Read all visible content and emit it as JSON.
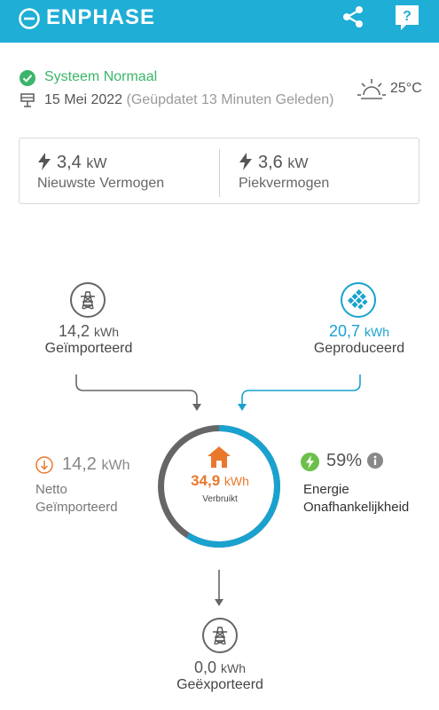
{
  "header": {
    "logo_text": "ENPHASE",
    "share_icon": "share-icon",
    "help_icon": "help-icon"
  },
  "status": {
    "text": "Systeem Normaal",
    "color": "#3ab56a"
  },
  "date": {
    "date": "15 Mei 2022",
    "updated": "(Geüpdatet 13 Minuten Geleden)"
  },
  "weather": {
    "icon": "partly-sunny-icon",
    "temperature": "25°C"
  },
  "power": {
    "latest": {
      "value": "3,4",
      "unit": "kW",
      "label": "Nieuwste Vermogen"
    },
    "peak": {
      "value": "3,6",
      "unit": "kW",
      "label": "Piekvermogen"
    }
  },
  "energy": {
    "imported": {
      "value": "14,2",
      "unit": "kWh",
      "label": "Geïmporteerd"
    },
    "produced": {
      "value": "20,7",
      "unit": "kWh",
      "label": "Geproduceerd"
    },
    "consumed": {
      "value": "34,9",
      "unit": "kWh",
      "label": "Verbruikt",
      "produced_fraction": 0.59
    },
    "net_imported": {
      "value": "14,2",
      "unit": "kWh",
      "label_line1": "Netto",
      "label_line2": "Geïmporteerd"
    },
    "independence": {
      "value": "59%",
      "label_line1": "Energie",
      "label_line2": "Onafhankelijkheid"
    },
    "exported": {
      "value": "0,0",
      "unit": "kWh",
      "label": "Geëxporteerd"
    }
  },
  "colors": {
    "brand": "#1eaed6",
    "solar": "#1aa2cf",
    "grid": "#666666",
    "consumption": "#e9782d",
    "status_ok": "#3ab56a",
    "independence": "#6cc04a"
  }
}
